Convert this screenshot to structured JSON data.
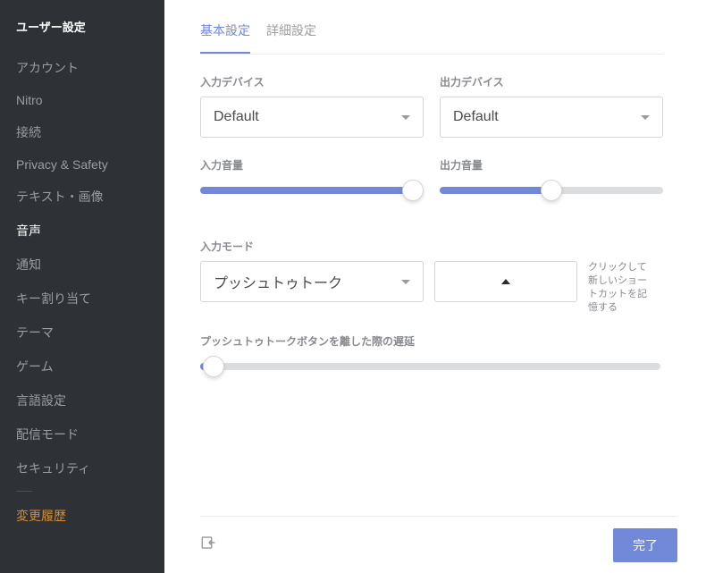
{
  "sidebar": {
    "title": "ユーザー設定",
    "items": [
      {
        "label": "アカウント",
        "active": false
      },
      {
        "label": "Nitro",
        "active": false
      },
      {
        "label": "接続",
        "active": false
      },
      {
        "label": "Privacy & Safety",
        "active": false
      },
      {
        "label": "テキスト・画像",
        "active": false
      },
      {
        "label": "音声",
        "active": true
      },
      {
        "label": "通知",
        "active": false
      },
      {
        "label": "キー割り当て",
        "active": false
      },
      {
        "label": "テーマ",
        "active": false
      },
      {
        "label": "ゲーム",
        "active": false
      },
      {
        "label": "言語設定",
        "active": false
      },
      {
        "label": "配信モード",
        "active": false
      },
      {
        "label": "セキュリティ",
        "active": false
      }
    ],
    "changelog_label": "変更履歴"
  },
  "tabs": {
    "basic": "基本設定",
    "advanced": "詳細設定"
  },
  "input_device": {
    "label": "入力デバイス",
    "value": "Default"
  },
  "output_device": {
    "label": "出力デバイス",
    "value": "Default"
  },
  "input_volume": {
    "label": "入力音量",
    "percent": 95
  },
  "output_volume": {
    "label": "出力音量",
    "percent": 50
  },
  "input_mode": {
    "label": "入力モード",
    "value": "プッシュトゥトーク",
    "shortcut_hint": "クリックして新しいショートカットを記憶する"
  },
  "ptt_delay": {
    "label": "プッシュトゥトークボタンを離した際の遅延",
    "percent": 3
  },
  "footer": {
    "done": "完了"
  }
}
